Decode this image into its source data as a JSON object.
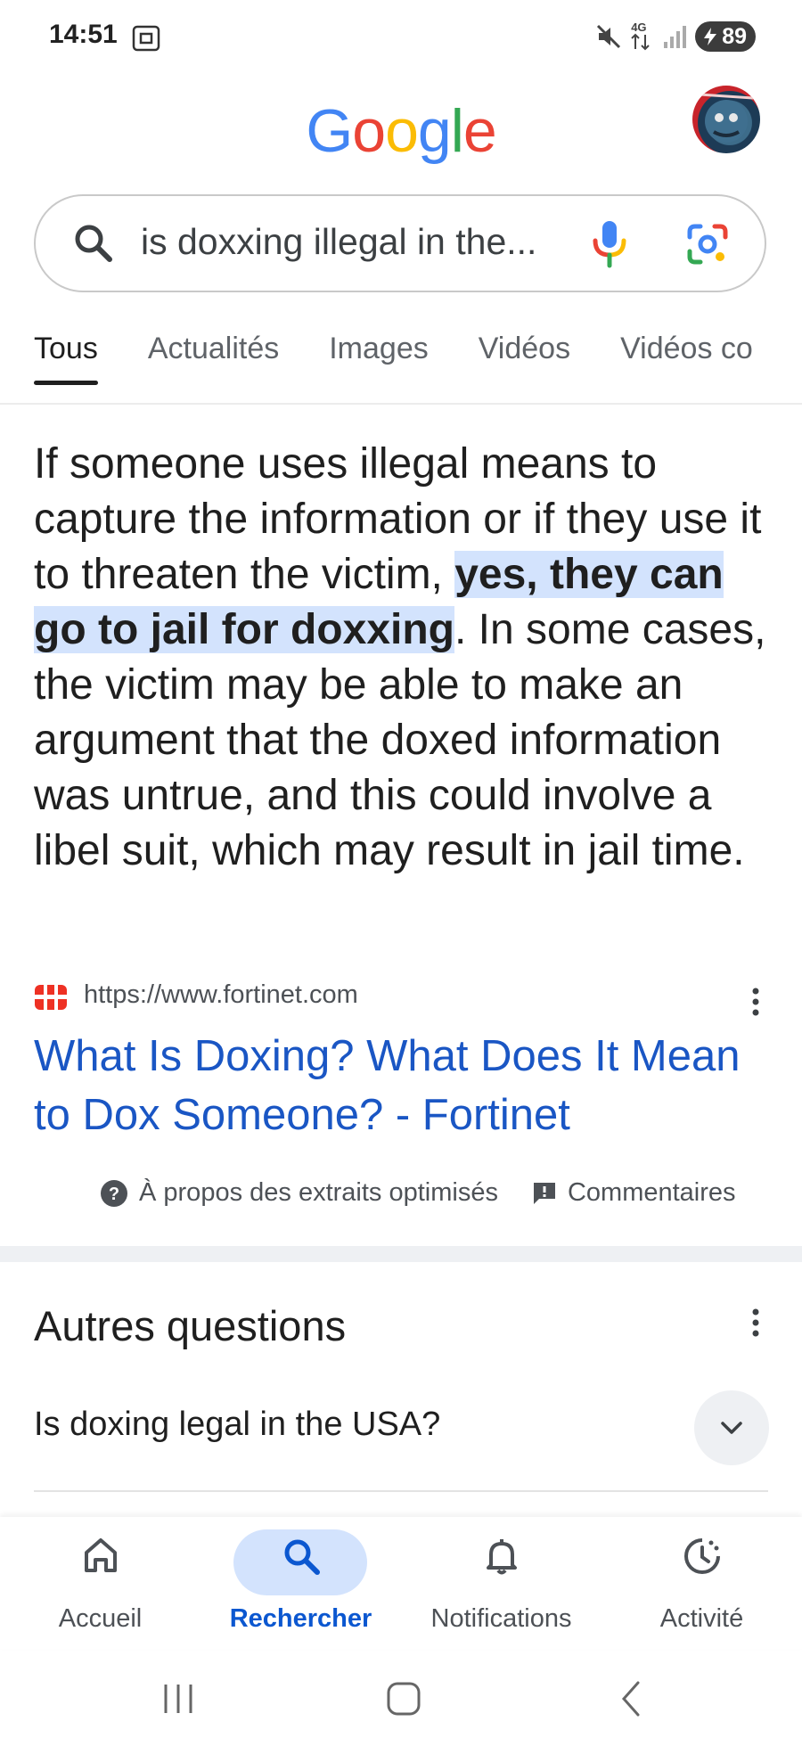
{
  "status_bar": {
    "time": "14:51",
    "battery": "89",
    "network": "4G"
  },
  "header": {
    "logo": [
      {
        "char": "G",
        "color": "#4285F4"
      },
      {
        "char": "o",
        "color": "#EA4335"
      },
      {
        "char": "o",
        "color": "#FBBC05"
      },
      {
        "char": "g",
        "color": "#4285F4"
      },
      {
        "char": "l",
        "color": "#34A853"
      },
      {
        "char": "e",
        "color": "#EA4335"
      }
    ]
  },
  "search": {
    "query": "is doxxing illegal in the..."
  },
  "tabs": [
    {
      "label": "Tous",
      "active": true
    },
    {
      "label": "Actualités",
      "active": false
    },
    {
      "label": "Images",
      "active": false
    },
    {
      "label": "Vidéos",
      "active": false
    },
    {
      "label": "Vidéos co",
      "active": false
    }
  ],
  "snippet": {
    "before": "If someone uses illegal means to capture the information or if they use it to threaten the victim, ",
    "highlight": "yes, they can go to jail for doxxing",
    "after": ". In some cases, the victim may be able to make an argument that the doxed information was untrue, and this could involve a libel suit, which may result in jail time."
  },
  "source": {
    "url": "https://www.fortinet.com",
    "title": "What Is Doxing? What Does It Mean to Dox Someone? - Fortinet"
  },
  "footer": {
    "about": "À propos des extraits optimisés",
    "feedback": "Commentaires"
  },
  "related": {
    "title": "Autres questions",
    "questions": [
      "Is doxing legal in the USA?"
    ]
  },
  "bottom_nav": [
    {
      "label": "Accueil",
      "icon": "home-icon",
      "active": false
    },
    {
      "label": "Rechercher",
      "icon": "search-icon",
      "active": true
    },
    {
      "label": "Notifications",
      "icon": "bell-icon",
      "active": false
    },
    {
      "label": "Activité",
      "icon": "activity-icon",
      "active": false
    }
  ],
  "colors": {
    "link": "#1a56c4",
    "highlight_bg": "#d3e3fd",
    "active_nav": "#0b57d0"
  }
}
